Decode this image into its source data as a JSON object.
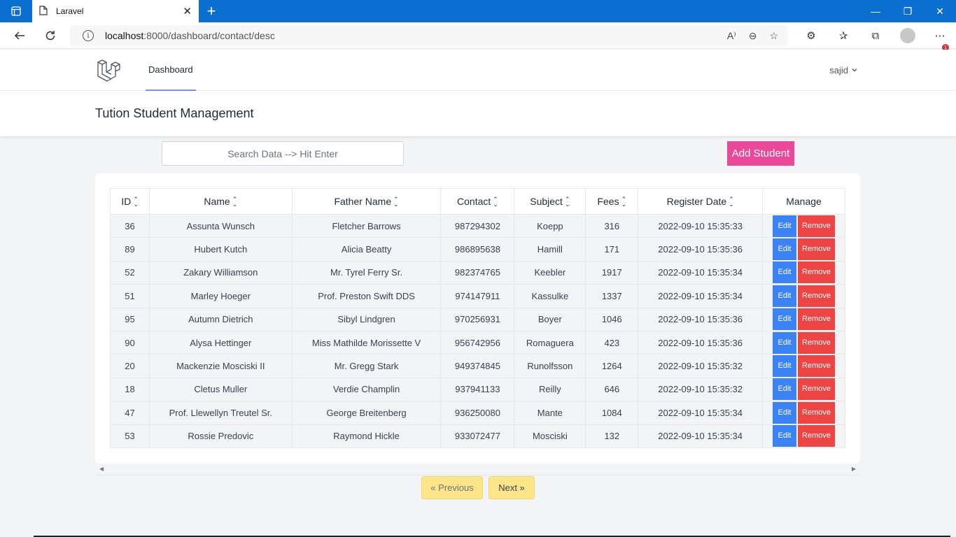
{
  "browser": {
    "tab_title": "Laravel",
    "url_host": "localhost",
    "url_path": ":8000/dashboard/contact/desc",
    "badge_count": "1"
  },
  "nav": {
    "dashboard_link": "Dashboard",
    "user_name": "sajid"
  },
  "page": {
    "title": "Tution Student Management",
    "search_placeholder": "Search Data --> Hit Enter",
    "add_button": "Add Student"
  },
  "table": {
    "headers": [
      "ID",
      "Name",
      "Father Name",
      "Contact",
      "Subject",
      "Fees",
      "Register Date",
      "Manage"
    ],
    "edit_label": "Edit",
    "remove_label": "Remove",
    "rows": [
      {
        "id": "36",
        "name": "Assunta Wunsch",
        "father": "Fletcher Barrows",
        "contact": "987294302",
        "subject": "Koepp",
        "fees": "316",
        "date": "2022-09-10 15:35:33"
      },
      {
        "id": "89",
        "name": "Hubert Kutch",
        "father": "Alicia Beatty",
        "contact": "986895638",
        "subject": "Hamill",
        "fees": "171",
        "date": "2022-09-10 15:35:36"
      },
      {
        "id": "52",
        "name": "Zakary Williamson",
        "father": "Mr. Tyrel Ferry Sr.",
        "contact": "982374765",
        "subject": "Keebler",
        "fees": "1917",
        "date": "2022-09-10 15:35:34"
      },
      {
        "id": "51",
        "name": "Marley Hoeger",
        "father": "Prof. Preston Swift DDS",
        "contact": "974147911",
        "subject": "Kassulke",
        "fees": "1337",
        "date": "2022-09-10 15:35:34"
      },
      {
        "id": "95",
        "name": "Autumn Dietrich",
        "father": "Sibyl Lindgren",
        "contact": "970256931",
        "subject": "Boyer",
        "fees": "1046",
        "date": "2022-09-10 15:35:36"
      },
      {
        "id": "90",
        "name": "Alysa Hettinger",
        "father": "Miss Mathilde Morissette V",
        "contact": "956742956",
        "subject": "Romaguera",
        "fees": "423",
        "date": "2022-09-10 15:35:36"
      },
      {
        "id": "20",
        "name": "Mackenzie Mosciski II",
        "father": "Mr. Gregg Stark",
        "contact": "949374845",
        "subject": "Runolfsson",
        "fees": "1264",
        "date": "2022-09-10 15:35:32"
      },
      {
        "id": "18",
        "name": "Cletus Muller",
        "father": "Verdie Champlin",
        "contact": "937941133",
        "subject": "Reilly",
        "fees": "646",
        "date": "2022-09-10 15:35:32"
      },
      {
        "id": "47",
        "name": "Prof. Llewellyn Treutel Sr.",
        "father": "George Breitenberg",
        "contact": "936250080",
        "subject": "Mante",
        "fees": "1084",
        "date": "2022-09-10 15:35:34"
      },
      {
        "id": "53",
        "name": "Rossie Predovic",
        "father": "Raymond Hickle",
        "contact": "933072477",
        "subject": "Mosciski",
        "fees": "132",
        "date": "2022-09-10 15:35:34"
      }
    ]
  },
  "pagination": {
    "previous": "« Previous",
    "next": "Next »"
  },
  "colors": {
    "add_button": "#ec4899",
    "edit_button": "#3b82f6",
    "remove_button": "#ef4444",
    "pager_button": "#fde68a"
  }
}
